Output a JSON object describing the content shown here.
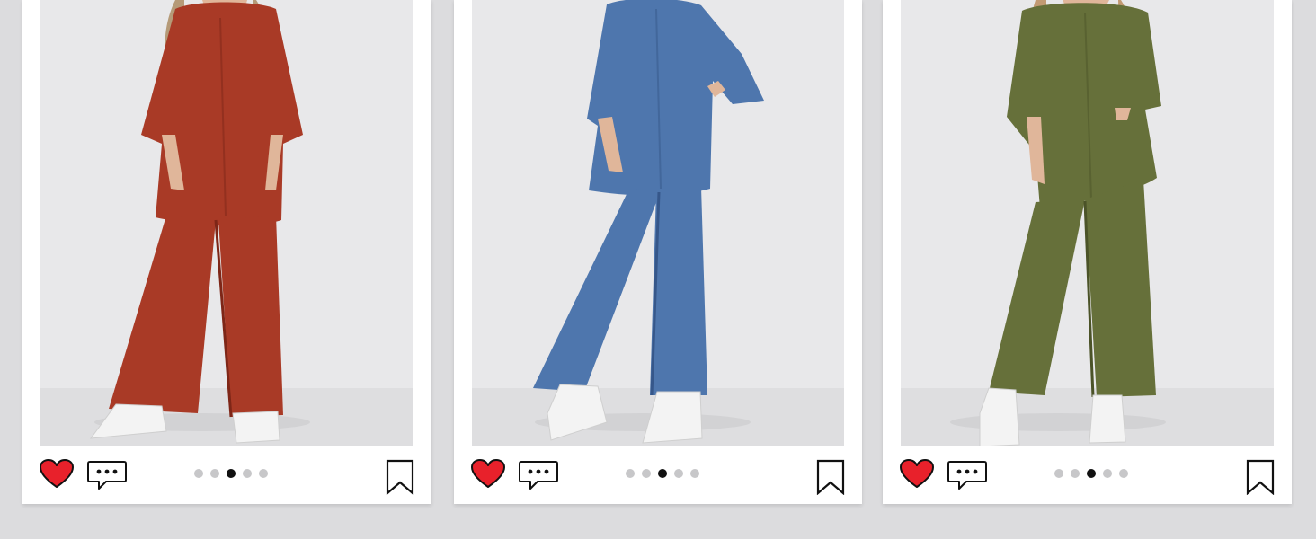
{
  "colors": {
    "page_background": "#dcdcde",
    "card_background": "#ffffff",
    "photo_backdrop": "#e8e8ea",
    "heart": "#e8212b",
    "dot_inactive": "#c7c7c9",
    "dot_active": "#111111"
  },
  "posts": [
    {
      "outfit_color": "#a93a26",
      "outfit_shadow": "#7e2617",
      "liked": true,
      "icons": [
        "heart-icon",
        "speech-bubble-icon",
        "bookmark-icon"
      ],
      "carousel": {
        "count": 5,
        "active_index": 2
      }
    },
    {
      "outfit_color": "#4e76ad",
      "outfit_shadow": "#36578a",
      "liked": true,
      "icons": [
        "heart-icon",
        "speech-bubble-icon",
        "bookmark-icon"
      ],
      "carousel": {
        "count": 5,
        "active_index": 2
      }
    },
    {
      "outfit_color": "#66703a",
      "outfit_shadow": "#4b5328",
      "liked": true,
      "icons": [
        "heart-icon",
        "speech-bubble-icon",
        "bookmark-icon"
      ],
      "carousel": {
        "count": 5,
        "active_index": 2
      }
    }
  ]
}
